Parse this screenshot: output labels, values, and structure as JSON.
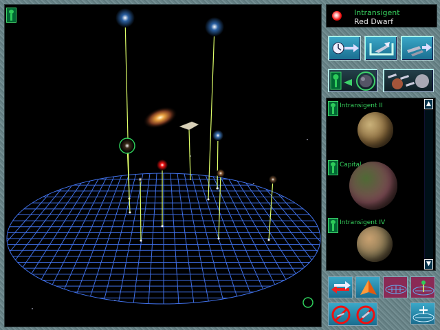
{
  "selected_star": {
    "name": "Intransigent",
    "type": "Red Dwarf",
    "color": "#e11111"
  },
  "planets": [
    {
      "name": "Intransigent II",
      "palette": [
        "#c9b17a",
        "#8a6a3c",
        "#4a3820"
      ]
    },
    {
      "name": "Capital",
      "palette": [
        "#4f6a35",
        "#7a4a52",
        "#2a2218"
      ]
    },
    {
      "name": "Intransigent IV",
      "palette": [
        "#c8a070",
        "#8a7a55",
        "#3a2c1c"
      ]
    }
  ],
  "scroll": {
    "up_arrow": "▲",
    "down_arrow": "▼"
  },
  "colors": {
    "accent_green": "#37d45f",
    "grid": "#3f6fe6",
    "stalk": "#dfff6a",
    "frame": "#6f8b8f"
  },
  "icons": {
    "corner": "alien-icon",
    "star_header": "red-star-icon",
    "toolbar": [
      "clock-arrow-icon",
      "ship-launch-icon",
      "fleet-move-icon",
      "alien-planet-link-icon",
      "planets-fleet-icon"
    ],
    "bottom": [
      "swap-arrows-icon",
      "pyramid-icon",
      "flat-grid-icon",
      "grid-center-icon",
      "no-ships-icon",
      "zoom-grid-icon"
    ]
  }
}
